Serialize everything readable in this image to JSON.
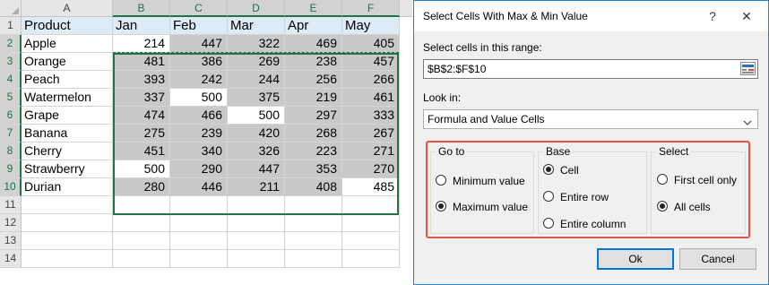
{
  "sheet": {
    "columns": [
      "A",
      "B",
      "C",
      "D",
      "E",
      "F"
    ],
    "rows": [
      "1",
      "2",
      "3",
      "4",
      "5",
      "6",
      "7",
      "8",
      "9",
      "10",
      "11",
      "12",
      "13",
      "14"
    ],
    "header": [
      "Product",
      "Jan",
      "Feb",
      "Mar",
      "Apr",
      "May"
    ],
    "data": [
      [
        "Apple",
        "214",
        "447",
        "322",
        "469",
        "405"
      ],
      [
        "Orange",
        "481",
        "386",
        "269",
        "238",
        "457"
      ],
      [
        "Peach",
        "393",
        "242",
        "244",
        "256",
        "266"
      ],
      [
        "Watermelon",
        "337",
        "500",
        "375",
        "219",
        "461"
      ],
      [
        "Grape",
        "474",
        "466",
        "500",
        "297",
        "333"
      ],
      [
        "Banana",
        "275",
        "239",
        "420",
        "268",
        "267"
      ],
      [
        "Cherry",
        "451",
        "340",
        "326",
        "223",
        "271"
      ],
      [
        "Strawberry",
        "500",
        "290",
        "447",
        "353",
        "270"
      ],
      [
        "Durian",
        "280",
        "446",
        "211",
        "408",
        "485"
      ]
    ]
  },
  "dialog": {
    "title": "Select Cells With Max & Min Value",
    "help": "?",
    "close": "✕",
    "range_label": "Select cells in this range:",
    "range_value": "$B$2:$F$10",
    "lookin_label": "Look in:",
    "lookin_value": "Formula and Value Cells",
    "goto": {
      "title": "Go to",
      "options": [
        "Minimum value",
        "Maximum value"
      ],
      "selected": "Maximum value"
    },
    "base": {
      "title": "Base",
      "options": [
        "Cell",
        "Entire row",
        "Entire column"
      ],
      "selected": "Cell"
    },
    "select": {
      "title": "Select",
      "options": [
        "First cell only",
        "All cells"
      ],
      "selected": "All cells"
    },
    "ok_label": "Ok",
    "cancel_label": "Cancel",
    "accent_color": "#0078d7",
    "highlight_color": "#e2554f"
  }
}
